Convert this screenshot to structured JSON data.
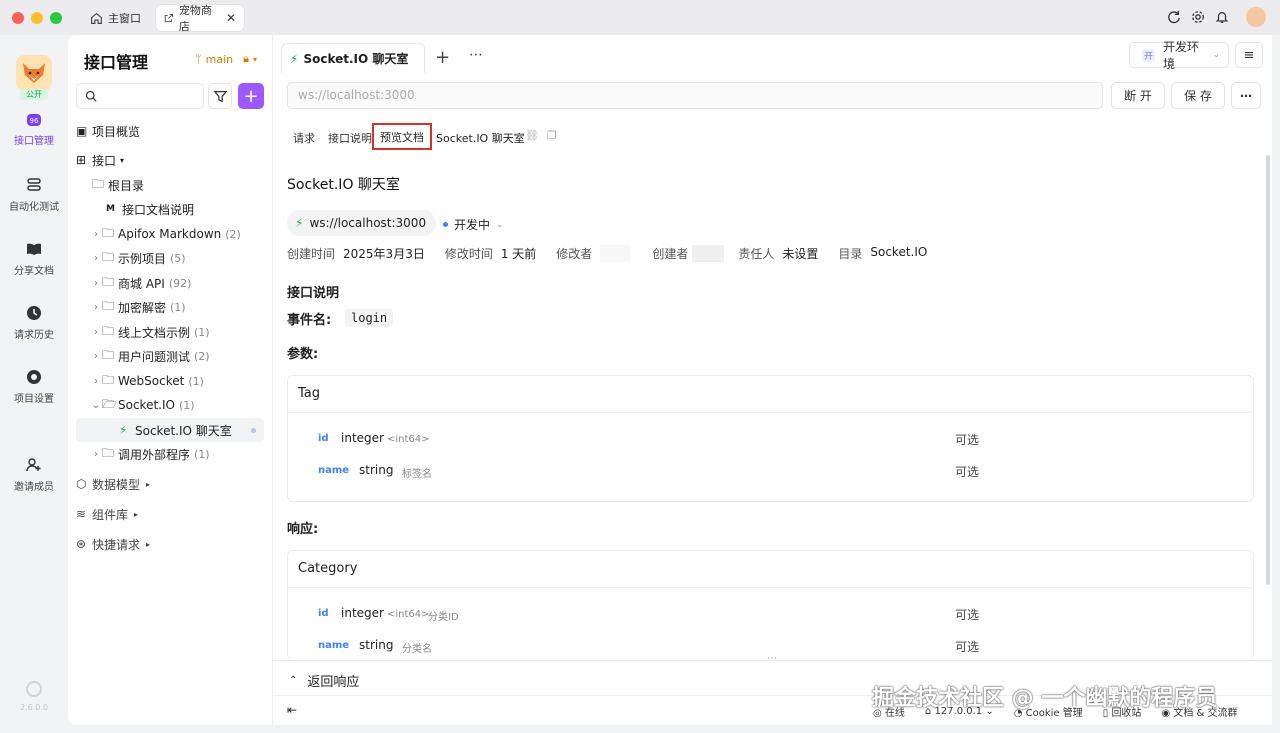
{
  "titlebar": {
    "tabs": [
      {
        "label": "主窗口",
        "icon": "home-icon"
      },
      {
        "label": "宠物商店",
        "icon": "external-link-icon"
      }
    ]
  },
  "leftbar": {
    "badge": "公开",
    "items": [
      {
        "label": "接口管理",
        "icon": "api-icon"
      },
      {
        "label": "自动化测试",
        "icon": "layers-icon"
      },
      {
        "label": "分享文档",
        "icon": "book-icon"
      },
      {
        "label": "请求历史",
        "icon": "clock-icon"
      },
      {
        "label": "项目设置",
        "icon": "gear-icon"
      },
      {
        "label": "邀请成员",
        "icon": "add-user-icon"
      }
    ],
    "version": "2.6.0.0"
  },
  "sidebar": {
    "title": "接口管理",
    "branch": "main",
    "search_placeholder": "",
    "overview": "项目概览",
    "api_section": "接口",
    "root": "根目录",
    "doc_item": "接口文档说明",
    "folders": [
      {
        "label": "Apifox Markdown",
        "count": "(2)"
      },
      {
        "label": "示例项目",
        "count": "(5)"
      },
      {
        "label": "商城 API",
        "count": "(92)"
      },
      {
        "label": "加密解密",
        "count": "(1)"
      },
      {
        "label": "线上文档示例",
        "count": "(1)"
      },
      {
        "label": "用户问题测试",
        "count": "(2)"
      },
      {
        "label": "WebSocket",
        "count": "(1)"
      },
      {
        "label": "Socket.IO",
        "count": "(1)"
      }
    ],
    "selected_item": "Socket.IO 聊天室",
    "after_folder": {
      "label": "调用外部程序",
      "count": "(1)"
    },
    "sections": [
      "数据模型",
      "组件库",
      "快捷请求"
    ]
  },
  "main": {
    "tab_title": "Socket.IO 聊天室",
    "env_badge": "开",
    "env_label": "开发环境",
    "url_placeholder": "ws://localhost:3000",
    "disconnect_label": "断 开",
    "save_label": "保 存",
    "subtabs": [
      "请求",
      "接口说明",
      "预览文档"
    ],
    "subtab_title": "Socket.IO 聊天室",
    "doc": {
      "title": "Socket.IO 聊天室",
      "url": "ws://localhost:3000",
      "status": "开发中",
      "meta": [
        {
          "k": "创建时间",
          "v": "2025年3月3日"
        },
        {
          "k": "修改时间",
          "v": "1 天前"
        },
        {
          "k": "修改者",
          "v": ""
        },
        {
          "k": "创建者",
          "v": ""
        },
        {
          "k": "责任人",
          "v": "未设置"
        },
        {
          "k": "目录",
          "v": "Socket.IO"
        }
      ],
      "desc_heading": "接口说明",
      "event_label": "事件名:",
      "event_value": "login",
      "params_heading": "参数:",
      "params_card": {
        "title": "Tag",
        "fields": [
          {
            "name": "id",
            "type": "integer",
            "format": "<int64>",
            "desc": "",
            "optional": "可选"
          },
          {
            "name": "name",
            "type": "string",
            "format": "",
            "desc": "标签名",
            "optional": "可选"
          }
        ]
      },
      "response_heading": "响应:",
      "response_card": {
        "title": "Category",
        "fields": [
          {
            "name": "id",
            "type": "integer",
            "format": "<int64>",
            "desc": "分类ID",
            "optional": "可选"
          },
          {
            "name": "name",
            "type": "string",
            "format": "",
            "desc": "分类名",
            "optional": "可选"
          }
        ]
      }
    },
    "return_response": "返回响应",
    "status_bar": {
      "online": "在线",
      "proxy": "127.0.0.1",
      "cookie": "Cookie 管理",
      "trash": "回收站",
      "docs": "文档 & 交流群"
    }
  },
  "watermark": "掘金技术社区 @ 一个幽默的程序员",
  "colors": {
    "accent": "#9b59ff",
    "highlight_box": "#d93025",
    "link": "#3b82f6"
  }
}
